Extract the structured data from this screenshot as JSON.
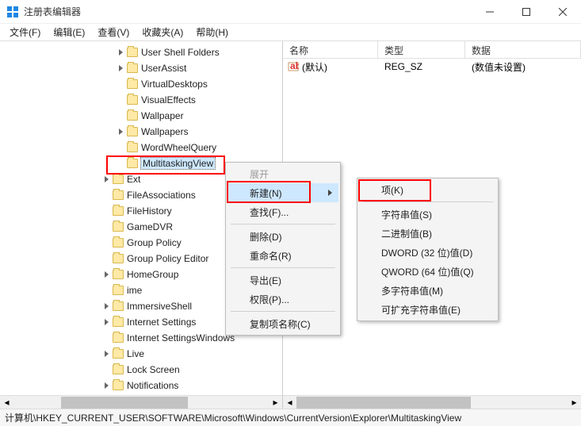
{
  "title": "注册表编辑器",
  "menubar": [
    "文件(F)",
    "编辑(E)",
    "查看(V)",
    "收藏夹(A)",
    "帮助(H)"
  ],
  "tree": {
    "items": [
      {
        "label": "User Shell Folders",
        "lvl": 1,
        "exp": true
      },
      {
        "label": "UserAssist",
        "lvl": 1,
        "exp": true
      },
      {
        "label": "VirtualDesktops",
        "lvl": 1,
        "exp": false
      },
      {
        "label": "VisualEffects",
        "lvl": 1,
        "exp": false
      },
      {
        "label": "Wallpaper",
        "lvl": 1,
        "exp": false
      },
      {
        "label": "Wallpapers",
        "lvl": 1,
        "exp": true
      },
      {
        "label": "WordWheelQuery",
        "lvl": 1,
        "exp": false
      },
      {
        "label": "MultitaskingView",
        "lvl": 1,
        "exp": false,
        "sel": true
      },
      {
        "label": "Ext",
        "lvl": 0,
        "exp": true
      },
      {
        "label": "FileAssociations",
        "lvl": 0,
        "exp": false
      },
      {
        "label": "FileHistory",
        "lvl": 0,
        "exp": false
      },
      {
        "label": "GameDVR",
        "lvl": 0,
        "exp": false
      },
      {
        "label": "Group Policy",
        "lvl": 0,
        "exp": false
      },
      {
        "label": "Group Policy Editor",
        "lvl": 0,
        "exp": false
      },
      {
        "label": "HomeGroup",
        "lvl": 0,
        "exp": true
      },
      {
        "label": "ime",
        "lvl": 0,
        "exp": false
      },
      {
        "label": "ImmersiveShell",
        "lvl": 0,
        "exp": true
      },
      {
        "label": "Internet Settings",
        "lvl": 0,
        "exp": true
      },
      {
        "label": "Internet SettingsWindows",
        "lvl": 0,
        "exp": false
      },
      {
        "label": "Live",
        "lvl": 0,
        "exp": true
      },
      {
        "label": "Lock Screen",
        "lvl": 0,
        "exp": false
      },
      {
        "label": "Notifications",
        "lvl": 0,
        "exp": true
      }
    ]
  },
  "columns": {
    "name": "名称",
    "type": "类型",
    "data": "数据"
  },
  "rows": [
    {
      "name": "(默认)",
      "type": "REG_SZ",
      "data": "(数值未设置)"
    }
  ],
  "ctx1": {
    "items": [
      {
        "label": "展开",
        "disabled": true
      },
      {
        "label": "新建(N)",
        "hover": true,
        "sub": true
      },
      {
        "label": "查找(F)...",
        "disabled": false
      },
      {
        "sep": true
      },
      {
        "label": "删除(D)"
      },
      {
        "label": "重命名(R)"
      },
      {
        "sep": true
      },
      {
        "label": "导出(E)"
      },
      {
        "label": "权限(P)..."
      },
      {
        "sep": true
      },
      {
        "label": "复制项名称(C)"
      }
    ]
  },
  "ctx2": {
    "items": [
      {
        "label": "项(K)"
      },
      {
        "sep": true
      },
      {
        "label": "字符串值(S)"
      },
      {
        "label": "二进制值(B)"
      },
      {
        "label": "DWORD (32 位)值(D)"
      },
      {
        "label": "QWORD (64 位)值(Q)"
      },
      {
        "label": "多字符串值(M)"
      },
      {
        "label": "可扩充字符串值(E)"
      }
    ]
  },
  "status": "计算机\\HKEY_CURRENT_USER\\SOFTWARE\\Microsoft\\Windows\\CurrentVersion\\Explorer\\MultitaskingView"
}
